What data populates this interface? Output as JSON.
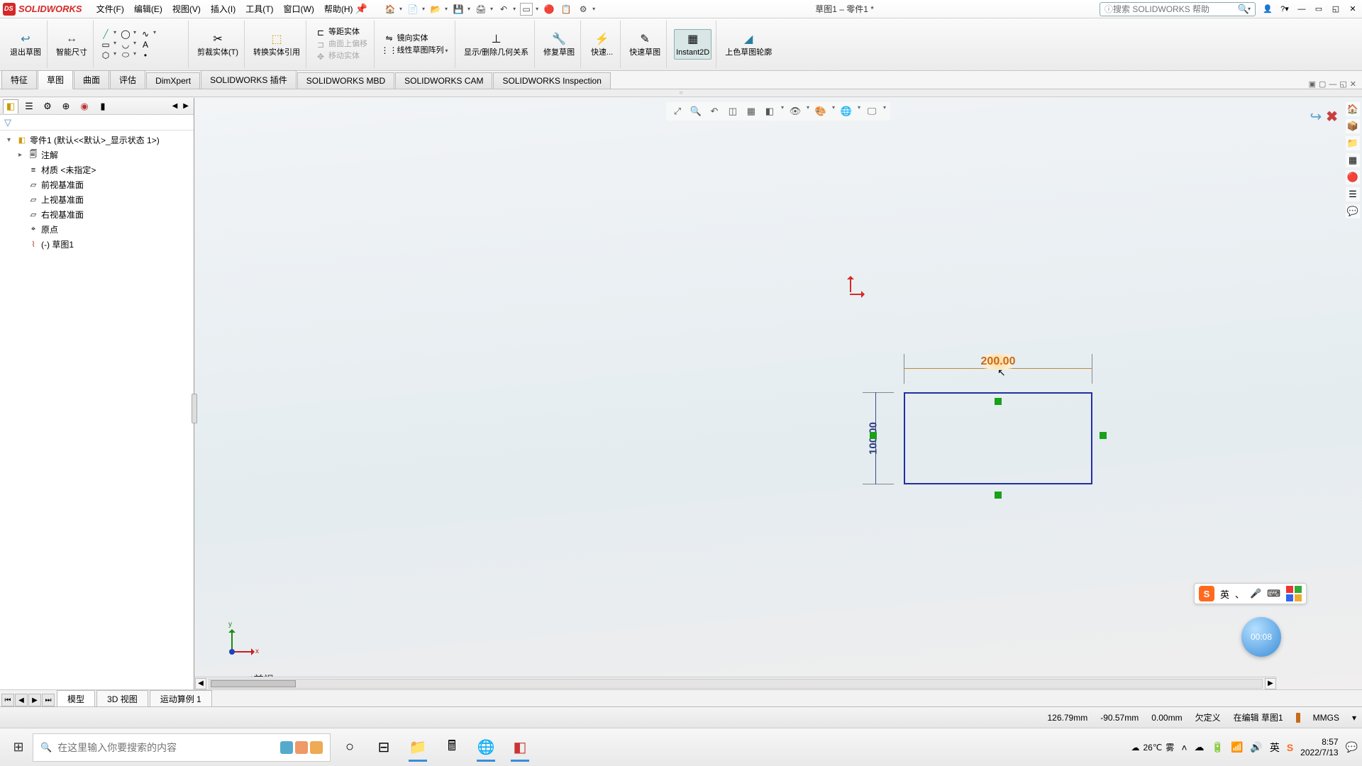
{
  "app": {
    "name": "SOLIDWORKS",
    "doc_title": "草图1 – 零件1 *"
  },
  "menus": {
    "file": "文件(F)",
    "edit": "编辑(E)",
    "view": "视图(V)",
    "insert": "插入(I)",
    "tools": "工具(T)",
    "window": "窗口(W)",
    "help": "帮助(H)"
  },
  "search": {
    "placeholder": "搜索 SOLIDWORKS 帮助"
  },
  "ribbon": {
    "exit_sketch": "退出草图",
    "smart_dim": "智能尺寸",
    "trim": "剪裁实体(T)",
    "convert": "转换实体引用",
    "offset": "等距实体",
    "surface_offset": "曲面上偏移",
    "move": "移动实体",
    "mirror": "镜向实体",
    "linear_pattern": "线性草图阵列",
    "show_rel": "显示/删除几何关系",
    "repair": "修复草图",
    "quick": "快速...",
    "quick_snap": "快速草图",
    "instant2d": "Instant2D",
    "shade": "上色草图轮廓"
  },
  "cmdtabs": {
    "features": "特征",
    "sketch": "草图",
    "surface": "曲面",
    "evaluate": "评估",
    "dimxpert": "DimXpert",
    "addins": "SOLIDWORKS 插件",
    "mbd": "SOLIDWORKS MBD",
    "cam": "SOLIDWORKS CAM",
    "inspection": "SOLIDWORKS Inspection"
  },
  "tree": {
    "root": "零件1  (默认<<默认>_显示状态 1>)",
    "annotations": "注解",
    "material": "材质 <未指定>",
    "front": "前视基准面",
    "top": "上视基准面",
    "right": "右视基准面",
    "origin": "原点",
    "sketch1": "(-) 草图1"
  },
  "dims": {
    "width": "200.00",
    "height": "100.00"
  },
  "view_label": "*前视",
  "triad": {
    "x": "x",
    "y": "y"
  },
  "timer": "00:08",
  "ime": {
    "lang": "英",
    "sep": "、"
  },
  "bottom_tabs": {
    "model": "模型",
    "3dview": "3D 视图",
    "motion": "运动算例 1"
  },
  "status": {
    "x": "126.79mm",
    "y": "-90.57mm",
    "z": "0.00mm",
    "def": "欠定义",
    "editing": "在编辑 草图1",
    "units": "MMGS"
  },
  "taskbar": {
    "search_placeholder": "在这里输入你要搜索的内容",
    "temp": "26℃",
    "weather": "雾",
    "time": "8:57",
    "date": "2022/7/13",
    "ime_ind": "英"
  }
}
